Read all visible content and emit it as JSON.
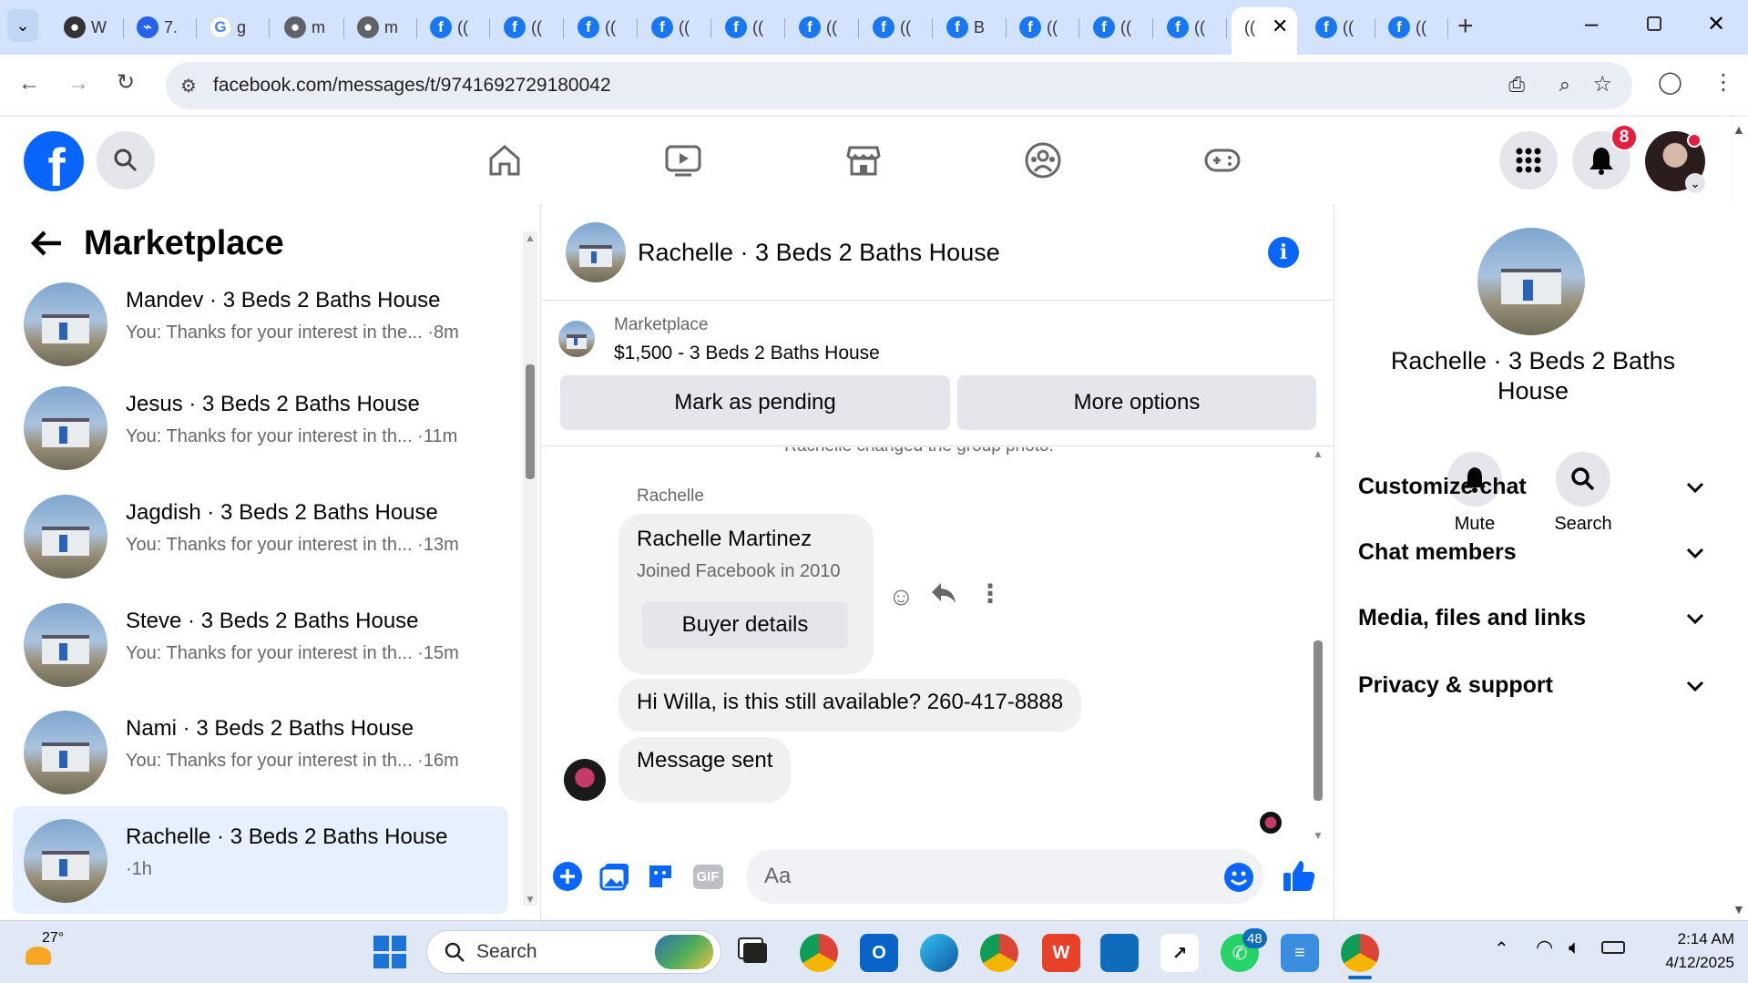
{
  "browser": {
    "tabs": [
      {
        "icon": "github-icon",
        "label": "W"
      },
      {
        "icon": "w-app-icon",
        "label": "7."
      },
      {
        "icon": "google-icon",
        "label": "g"
      },
      {
        "icon": "globe-icon",
        "label": "m"
      },
      {
        "icon": "globe-icon",
        "label": "m"
      },
      {
        "icon": "facebook-icon",
        "label": "(("
      },
      {
        "icon": "facebook-icon",
        "label": "(("
      },
      {
        "icon": "facebook-icon",
        "label": "(("
      },
      {
        "icon": "facebook-icon",
        "label": "(("
      },
      {
        "icon": "facebook-icon",
        "label": "(("
      },
      {
        "icon": "facebook-icon",
        "label": "(("
      },
      {
        "icon": "facebook-icon",
        "label": "(("
      },
      {
        "icon": "facebook-icon",
        "label": "B"
      },
      {
        "icon": "facebook-icon",
        "label": "(("
      },
      {
        "icon": "facebook-icon",
        "label": "(("
      },
      {
        "icon": "facebook-icon",
        "label": "(("
      },
      {
        "icon": "facebook-icon",
        "label": "(("
      },
      {
        "icon": "facebook-icon",
        "label": "(("
      },
      {
        "icon": "facebook-icon",
        "label": "(("
      }
    ],
    "active_tab_label": "((",
    "url": "facebook.com/messages/t/9741692729180042"
  },
  "header": {
    "notification_count": "8"
  },
  "marketplace": {
    "title": "Marketplace",
    "conversations": [
      {
        "name": "Mandev · 3 Beds 2 Baths House",
        "preview": "You: Thanks for your interest in the... ·8m"
      },
      {
        "name": "Jesus · 3 Beds 2 Baths House",
        "preview": "You: Thanks for your interest in th... ·11m"
      },
      {
        "name": "Jagdish · 3 Beds 2 Baths House",
        "preview": "You: Thanks for your interest in th... ·13m"
      },
      {
        "name": "Steve · 3 Beds 2 Baths House",
        "preview": "You: Thanks for your interest in th... ·15m"
      },
      {
        "name": "Nami · 3 Beds 2 Baths House",
        "preview": "You: Thanks for your interest in th... ·16m"
      },
      {
        "name": "Rachelle · 3 Beds 2 Baths House",
        "preview": "·1h"
      }
    ]
  },
  "chat": {
    "title": "Rachelle · 3 Beds 2 Baths House",
    "listing_source": "Marketplace",
    "listing_title": "$1,500 - 3 Beds 2 Baths House",
    "mark_pending": "Mark as pending",
    "more_options": "More options",
    "system_note": "Rachelle changed the group photo.",
    "sender_label": "Rachelle",
    "card_name": "Rachelle Martinez",
    "card_joined": "Joined Facebook in 2010",
    "buyer_details": "Buyer details",
    "message1": "Hi Willa, is this still available? 260-417-8888",
    "message2": "Message sent",
    "composer_placeholder": "Aa",
    "gif_label": "GIF"
  },
  "details": {
    "name": "Rachelle · 3 Beds 2 Baths House",
    "mute": "Mute",
    "search": "Search",
    "sections": [
      "Customize chat",
      "Chat members",
      "Media, files and links",
      "Privacy & support"
    ]
  },
  "taskbar": {
    "weather_temp": "27°",
    "search_label": "Search",
    "whatsapp_badge": "48",
    "time": "2:14 AM",
    "date": "4/12/2025"
  }
}
